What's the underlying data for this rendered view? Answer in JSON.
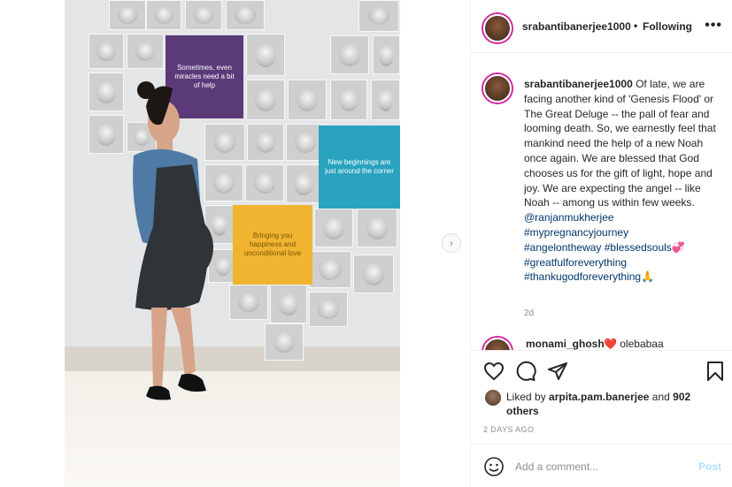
{
  "post": {
    "photo_texts": {
      "purple": "Sometimes, even miracles need a bit of help",
      "teal": "New beginnings are just around the corner",
      "yellow": "Bringing you happiness and unconditional love"
    }
  },
  "header": {
    "username": "srabantibanerjee1000",
    "separator": "•",
    "follow_status": "Following",
    "more_icon": "more-horizontal-icon"
  },
  "caption": {
    "username": "srabantibanerjee1000",
    "text": "Of late, we are facing another kind of 'Genesis Flood' or The Great Deluge -- the pall of fear and looming death. So, we earnestly feel that mankind need the help of a new Noah once again. We are blessed that God chooses us for the gift of light, hope and joy. We are expecting the angel -- like Noah -- among us within few weeks.",
    "tags": [
      "@ranjanmukherjee",
      "#mypregnancyjourney",
      "#angelontheway #blessedsouls💞",
      "#greatfulforeverything",
      "#thankugodforeverything🙏"
    ],
    "age": "2d"
  },
  "comment_preview": {
    "username": "monami_ghosh",
    "text": "❤️ olebabaa"
  },
  "actions": {
    "like_icon": "heart-icon",
    "comment_icon": "comment-icon",
    "share_icon": "send-icon",
    "save_icon": "bookmark-icon"
  },
  "likes": {
    "prefix": "Liked by",
    "user": "arpita.pam.banerjee",
    "middle": "and",
    "others": "902 others"
  },
  "timestamp": "2 DAYS AGO",
  "add_comment": {
    "placeholder": "Add a comment...",
    "post_label": "Post",
    "emoji_icon": "emoji-icon"
  },
  "colors": {
    "link": "#00376b",
    "muted": "#8e8e8e",
    "post_disabled": "#b2dffc",
    "story_ring": "#d6249f"
  }
}
